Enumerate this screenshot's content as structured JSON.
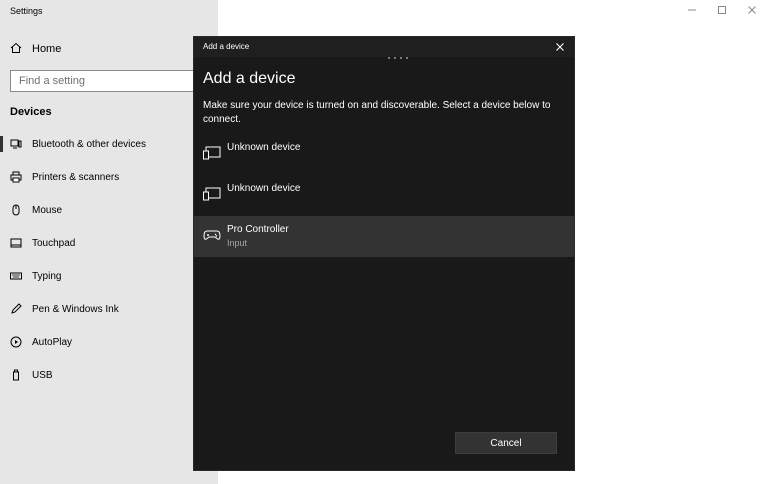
{
  "window": {
    "title": "Settings",
    "controls": [
      "minimize-icon",
      "maximize-icon",
      "close-icon"
    ]
  },
  "sidebar": {
    "home_label": "Home",
    "search_placeholder": "Find a setting",
    "section_title": "Devices",
    "items": [
      {
        "label": "Bluetooth & other devices",
        "icon": "bluetooth-devices-icon",
        "active": true
      },
      {
        "label": "Printers & scanners",
        "icon": "printer-icon"
      },
      {
        "label": "Mouse",
        "icon": "mouse-icon"
      },
      {
        "label": "Touchpad",
        "icon": "touchpad-icon"
      },
      {
        "label": "Typing",
        "icon": "keyboard-icon"
      },
      {
        "label": "Pen & Windows Ink",
        "icon": "pen-icon"
      },
      {
        "label": "AutoPlay",
        "icon": "autoplay-icon"
      },
      {
        "label": "USB",
        "icon": "usb-icon"
      }
    ]
  },
  "dialog": {
    "titlebar": "Add a device",
    "heading": "Add a device",
    "description": "Make sure your device is turned on and discoverable. Select a device below to connect.",
    "devices": [
      {
        "name": "Unknown device",
        "subtitle": "",
        "icon": "display-device-icon"
      },
      {
        "name": "Unknown device",
        "subtitle": "",
        "icon": "display-device-icon"
      },
      {
        "name": "Pro Controller",
        "subtitle": "Input",
        "icon": "gamepad-icon",
        "selected": true
      }
    ],
    "cancel_label": "Cancel"
  },
  "colors": {
    "dialog_bg": "#191919",
    "selected_row": "#333333",
    "sidebar_bg": "#e6e6e6"
  }
}
